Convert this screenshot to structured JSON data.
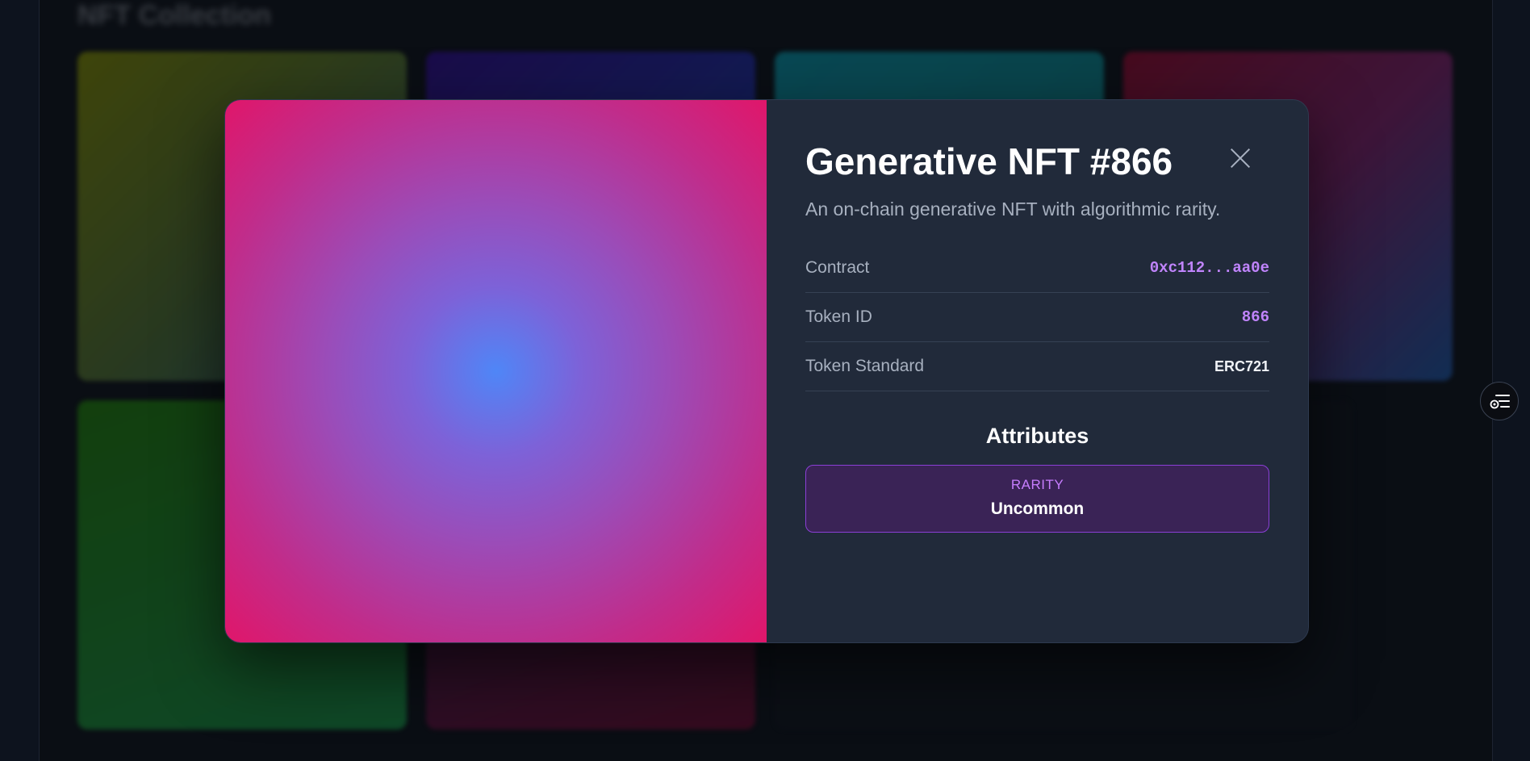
{
  "gallery": {
    "title": "NFT Collection"
  },
  "modal": {
    "title": "Generative NFT #866",
    "description": "An on-chain generative NFT with algorithmic rarity.",
    "properties": [
      {
        "label": "Contract",
        "value": "0xc112...aa0e"
      },
      {
        "label": "Token ID",
        "value": "866"
      },
      {
        "label": "Token Standard",
        "value": "ERC721"
      }
    ],
    "attributes_heading": "Attributes",
    "attributes": [
      {
        "trait_type": "RARITY",
        "value": "Uncommon"
      }
    ]
  },
  "icons": {
    "close": "close-icon",
    "floating_action": "menu-settings-icon"
  },
  "colors": {
    "accent": "#c084fc",
    "attribute_border": "#8b3fd6",
    "modal_bg": "#212a3a"
  }
}
